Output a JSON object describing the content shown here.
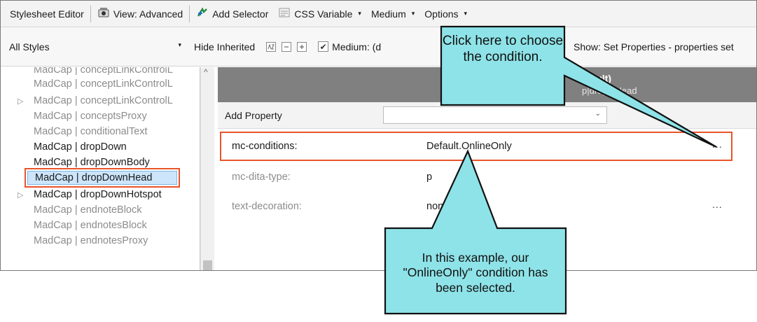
{
  "toolbar1": {
    "title": "Stylesheet Editor",
    "view": "View: Advanced",
    "add_selector": "Add Selector",
    "css_variable": "CSS Variable",
    "medium": "Medium",
    "options": "Options",
    "dropdown_caret": "▾"
  },
  "toolbar2": {
    "all_styles": "All Styles",
    "hide_inherited": "Hide Inherited",
    "medium_check": "Medium: (d",
    "show_filter": "Show: Set Properties - properties set"
  },
  "styles": [
    {
      "label": "MadCap | conceptLinkControlL",
      "expandable": false,
      "active": false
    },
    {
      "label": "MadCap | conceptLinkControlL",
      "expandable": false,
      "active": false
    },
    {
      "label": "MadCap | conceptLinkControlL",
      "expandable": true,
      "active": false
    },
    {
      "label": "MadCap | conceptsProxy",
      "expandable": false,
      "active": false
    },
    {
      "label": "MadCap | conditionalText",
      "expandable": false,
      "active": false
    },
    {
      "label": "MadCap | dropDown",
      "expandable": false,
      "active": true
    },
    {
      "label": "MadCap | dropDownBody",
      "expandable": false,
      "active": true
    },
    {
      "label": "MadCap | dropDownHead",
      "expandable": false,
      "active": true,
      "selected": true
    },
    {
      "label": "MadCap | dropDownHotspot",
      "expandable": true,
      "active": true
    },
    {
      "label": "MadCap | endnoteBlock",
      "expandable": false,
      "active": false
    },
    {
      "label": "MadCap | endnotesBlock",
      "expandable": false,
      "active": false
    },
    {
      "label": "MadCap | endnotesProxy",
      "expandable": false,
      "active": false
    }
  ],
  "header": {
    "line1": "efault)",
    "line2": "p|dropd    Head"
  },
  "add_property": {
    "label": "Add Property",
    "value": ""
  },
  "properties": [
    {
      "name": "mc-conditions:",
      "value": "Default.OnlineOnly",
      "more": "...",
      "highlighted": true
    },
    {
      "name": "mc-dita-type:",
      "value": "p",
      "more": ""
    },
    {
      "name": "text-decoration:",
      "value": "none",
      "more": "..."
    }
  ],
  "callouts": {
    "top": "Click here to choose the condition.",
    "bottom": "In this example, our \"OnlineOnly\" condition has been selected."
  },
  "colors": {
    "callout_fill": "#8ee3e8",
    "highlight_border": "#e8542a",
    "selection_fill": "#cce5fb",
    "header_band": "#808080"
  }
}
